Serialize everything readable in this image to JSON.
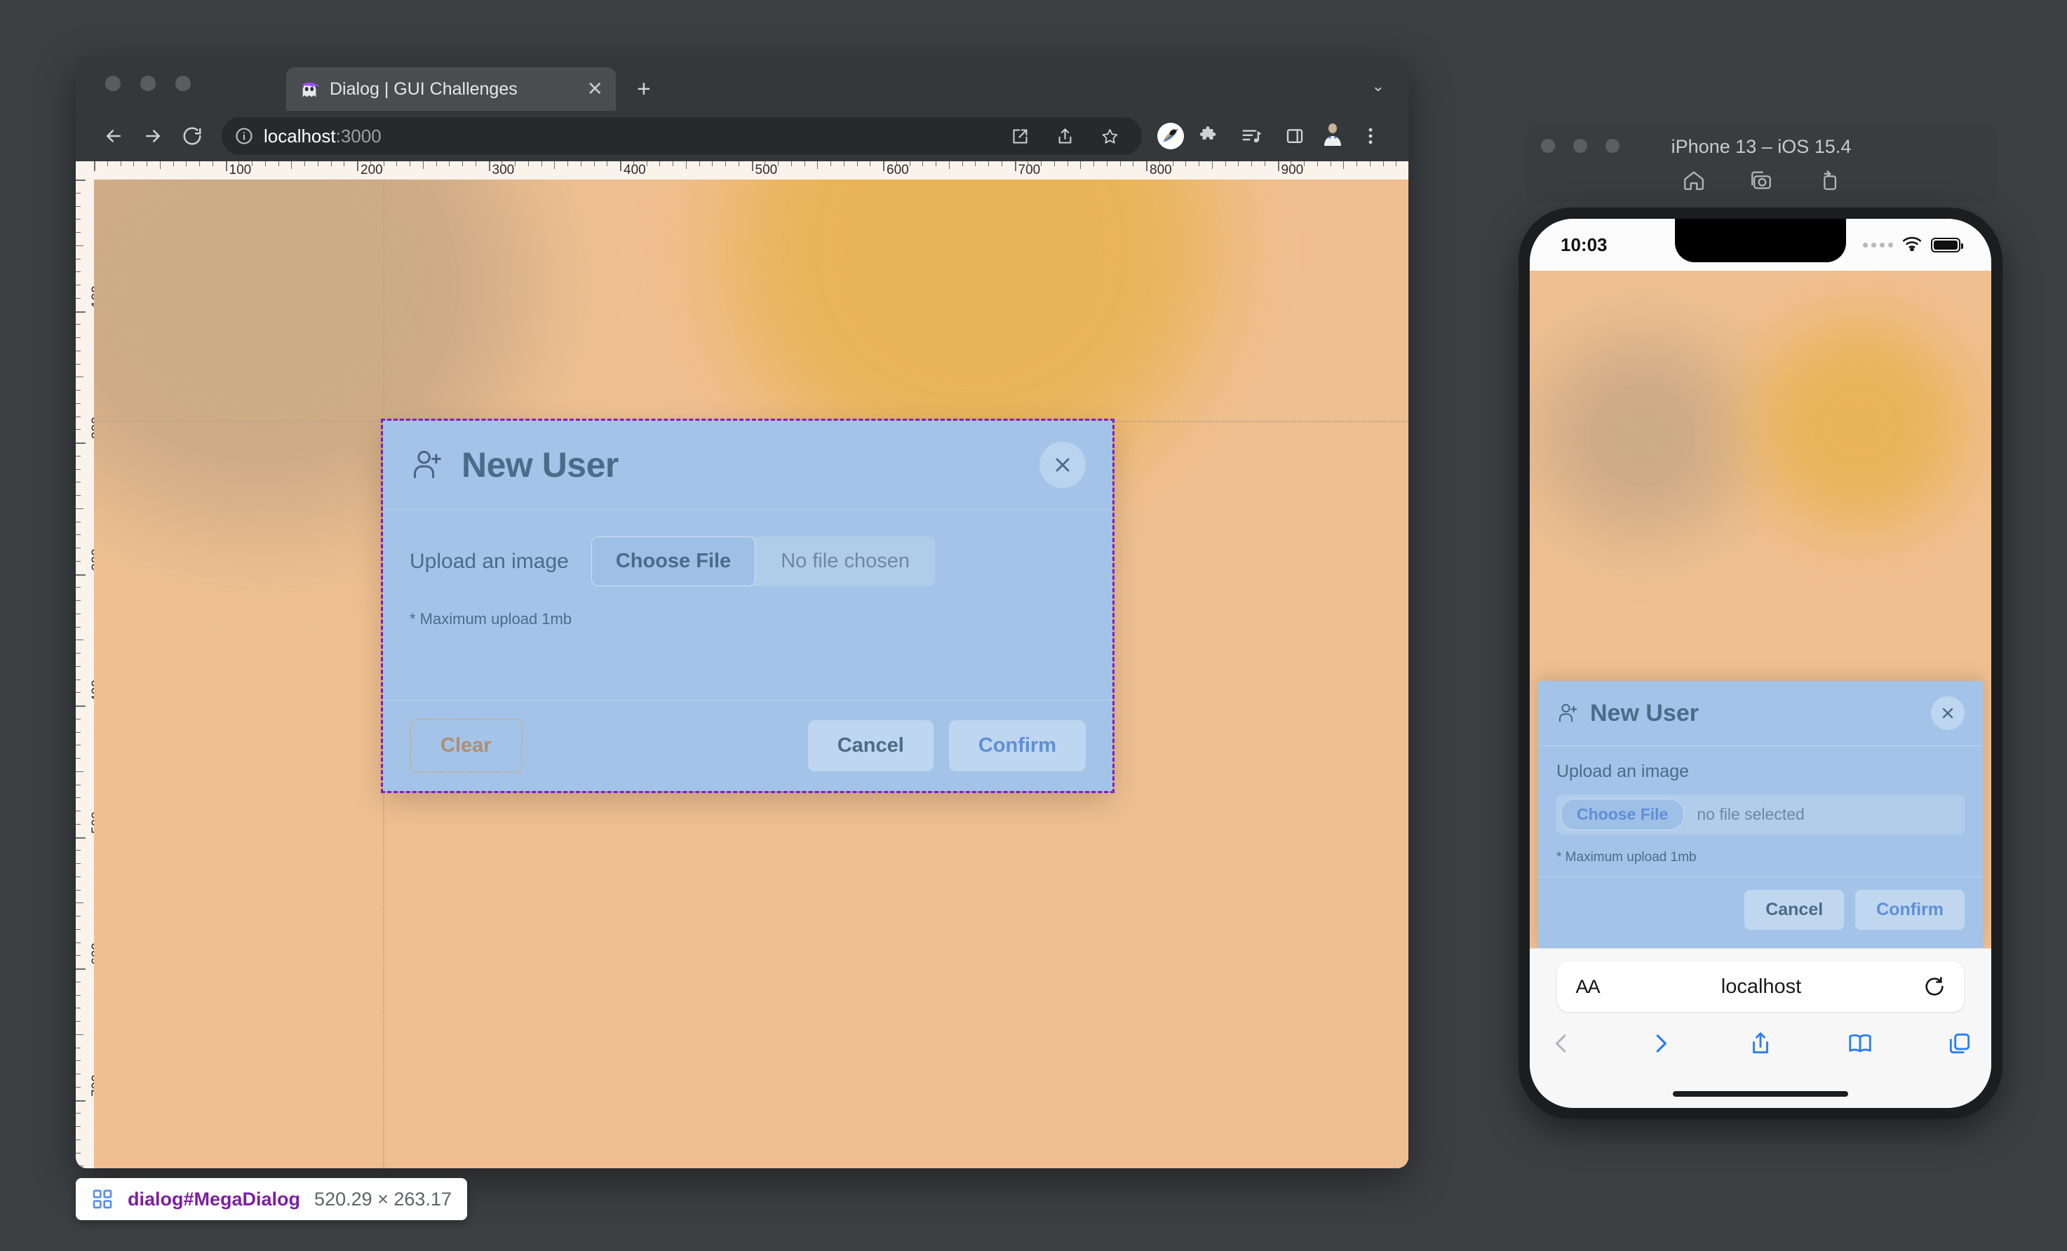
{
  "browser": {
    "tab": {
      "title": "Dialog | GUI Challenges",
      "favicon": "ghost-pirate-icon",
      "close_label": "✕"
    },
    "new_tab_label": "+",
    "tab_list_chevron": "⌄",
    "omnibox": {
      "url_host": "localhost",
      "url_port": ":3000",
      "info_icon": "info-circle-icon"
    },
    "nav": {
      "back": "back-arrow-icon",
      "forward": "forward-arrow-icon",
      "reload": "reload-icon"
    },
    "toolbar_icons": [
      "open-in-new-icon",
      "share-icon",
      "bookmark-star-icon",
      "moon-theme-icon",
      "extensions-puzzle-icon",
      "media-playlist-icon",
      "side-panel-icon",
      "profile-avatar-icon",
      "three-dot-menu-icon"
    ]
  },
  "rulers": {
    "horizontal_labels": [
      "100",
      "200",
      "300",
      "400",
      "500",
      "600",
      "700",
      "800",
      "900"
    ],
    "vertical_labels": [
      "100",
      "200",
      "300",
      "400",
      "500",
      "600"
    ],
    "unit_step": 100
  },
  "devtools_badge": {
    "selector": "dialog#MegaDialog",
    "dimensions": "520.29 × 263.17",
    "icon": "grid-squares-icon",
    "selector_color": "#7b1fa2"
  },
  "dialog": {
    "icon": "user-add-icon",
    "title": "New User",
    "close_label": "close-icon",
    "upload_label": "Upload an image",
    "choose_file_label": "Choose File",
    "file_status": "No file chosen",
    "hint": "* Maximum upload 1mb",
    "buttons": {
      "clear": "Clear",
      "cancel": "Cancel",
      "confirm": "Confirm"
    }
  },
  "simulator": {
    "window_title": "iPhone 13 – iOS 15.4",
    "tools": [
      "home-icon",
      "screenshot-camera-icon",
      "rotate-device-icon"
    ],
    "status": {
      "time": "10:03",
      "signal": "signal-dots-icon",
      "wifi": "wifi-icon",
      "battery": "battery-icon"
    },
    "dialog": {
      "icon": "user-add-icon",
      "title": "New User",
      "close_label": "close-icon",
      "upload_label": "Upload an image",
      "choose_file_label": "Choose File",
      "file_status": "no file selected",
      "hint": "* Maximum upload 1mb",
      "buttons": {
        "cancel": "Cancel",
        "confirm": "Confirm"
      }
    },
    "safari": {
      "text_size_label": "AA",
      "host": "localhost",
      "reload_icon": "reload-icon",
      "tools": [
        "back-chevron-icon",
        "forward-chevron-icon",
        "share-icon",
        "bookmarks-book-icon",
        "tabs-icon"
      ]
    }
  },
  "colors": {
    "page_background": "#efbf91",
    "dialog_background": "#a3c4e8",
    "dialog_text": "#4b6b88",
    "confirm_text": "#5f8fd6",
    "devtools_purple": "#7b1fd0",
    "window_chrome": "#35383b"
  }
}
